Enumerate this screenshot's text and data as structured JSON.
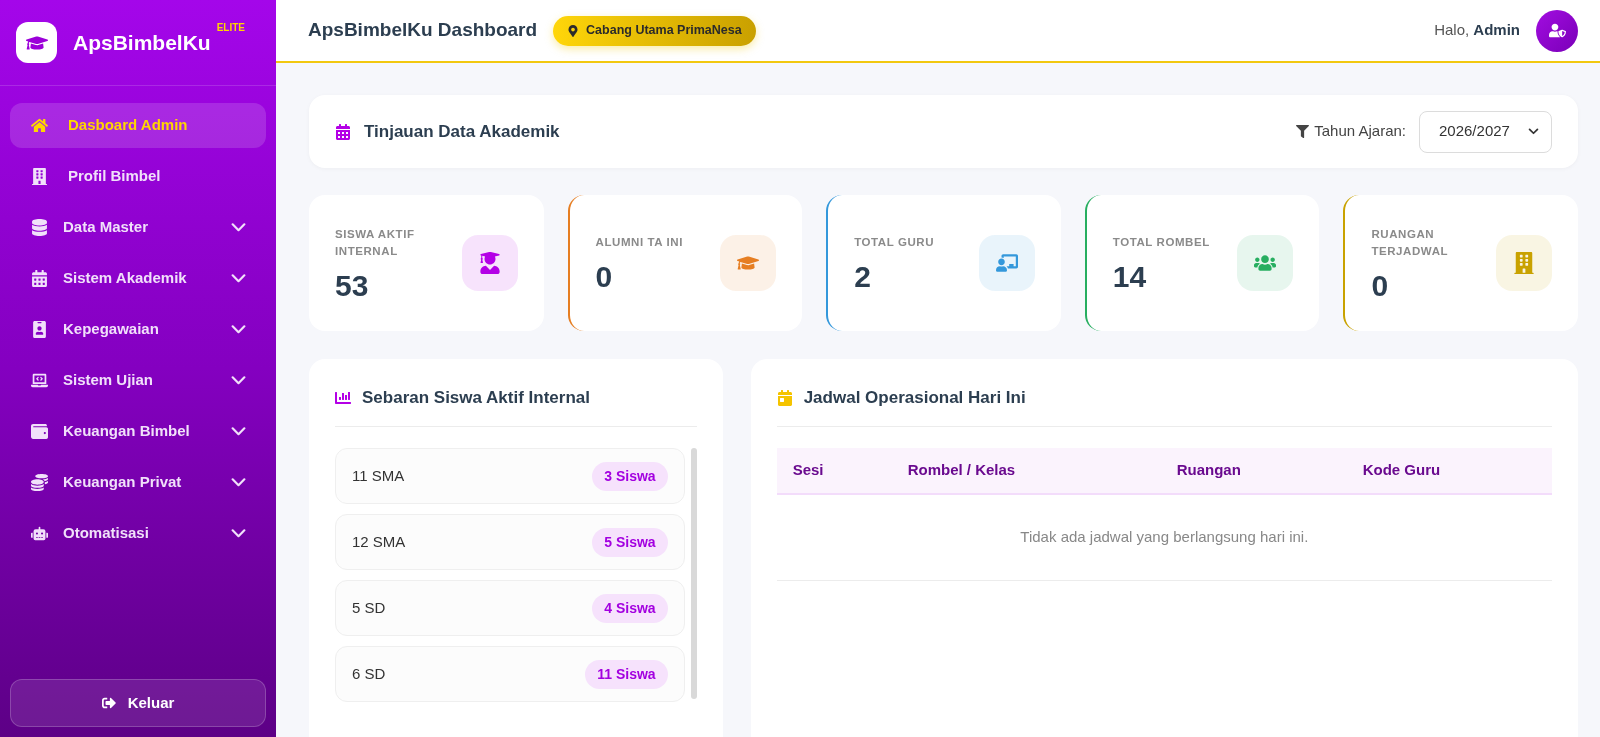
{
  "sidebar": {
    "brand": "ApsBimbelKu",
    "edition": "ELITE",
    "items": [
      {
        "label": "Dasboard Admin",
        "kind": "link",
        "selected": true
      },
      {
        "label": "Profil Bimbel",
        "kind": "link",
        "selected": false
      },
      {
        "label": "Data Master",
        "kind": "group",
        "selected": false,
        "expanded": false
      },
      {
        "label": "Sistem Akademik",
        "kind": "group",
        "selected": false,
        "expanded": false
      },
      {
        "label": "Kepegawaian",
        "kind": "group",
        "selected": false,
        "expanded": false
      },
      {
        "label": "Sistem Ujian",
        "kind": "group",
        "selected": false,
        "expanded": false
      },
      {
        "label": "Keuangan Bimbel",
        "kind": "group",
        "selected": false,
        "expanded": false
      },
      {
        "label": "Keuangan Privat",
        "kind": "group",
        "selected": false,
        "expanded": false
      },
      {
        "label": "Otomatisasi",
        "kind": "group",
        "selected": false,
        "expanded": false
      }
    ],
    "logout": "Keluar"
  },
  "header": {
    "title": "ApsBimbelKu Dashboard",
    "branch": "Cabang Utama PrimaNesa",
    "greeting": "Halo, **Admin**"
  },
  "overview": {
    "title": "Tinjauan Data Akademik",
    "filter_label": "Tahun Ajaran:",
    "year_select": {
      "value": "2026/2027"
    }
  },
  "stats": [
    {
      "label": "SISWA AKTIF INTERNAL",
      "value": "53",
      "color": "#b400e6",
      "bordered": false
    },
    {
      "label": "ALUMNI TA INI",
      "value": "0",
      "color": "#e67e22",
      "bordered": true
    },
    {
      "label": "TOTAL GURU",
      "value": "2",
      "color": "#3498db",
      "bordered": true
    },
    {
      "label": "TOTAL ROMBEL",
      "value": "14",
      "color": "#27ae60",
      "bordered": true
    },
    {
      "label": "RUANGAN TERJADWAL",
      "value": "0",
      "color": "#c9a200",
      "bordered": true
    }
  ],
  "distribution": {
    "title": "Sebaran Siswa Aktif Internal",
    "items": [
      {
        "label": "11 SMA",
        "count": "3 Siswa"
      },
      {
        "label": "12 SMA",
        "count": "5 Siswa"
      },
      {
        "label": "5 SD",
        "count": "4 Siswa"
      },
      {
        "label": "6 SD",
        "count": "11 Siswa"
      }
    ]
  },
  "schedule": {
    "title": "Jadwal Operasional Hari Ini",
    "columns": [
      "Sesi",
      "Rombel / Kelas",
      "Ruangan",
      "Kode Guru"
    ],
    "empty_message": "Tidak ada jadwal yang berlangsung hari ini."
  }
}
